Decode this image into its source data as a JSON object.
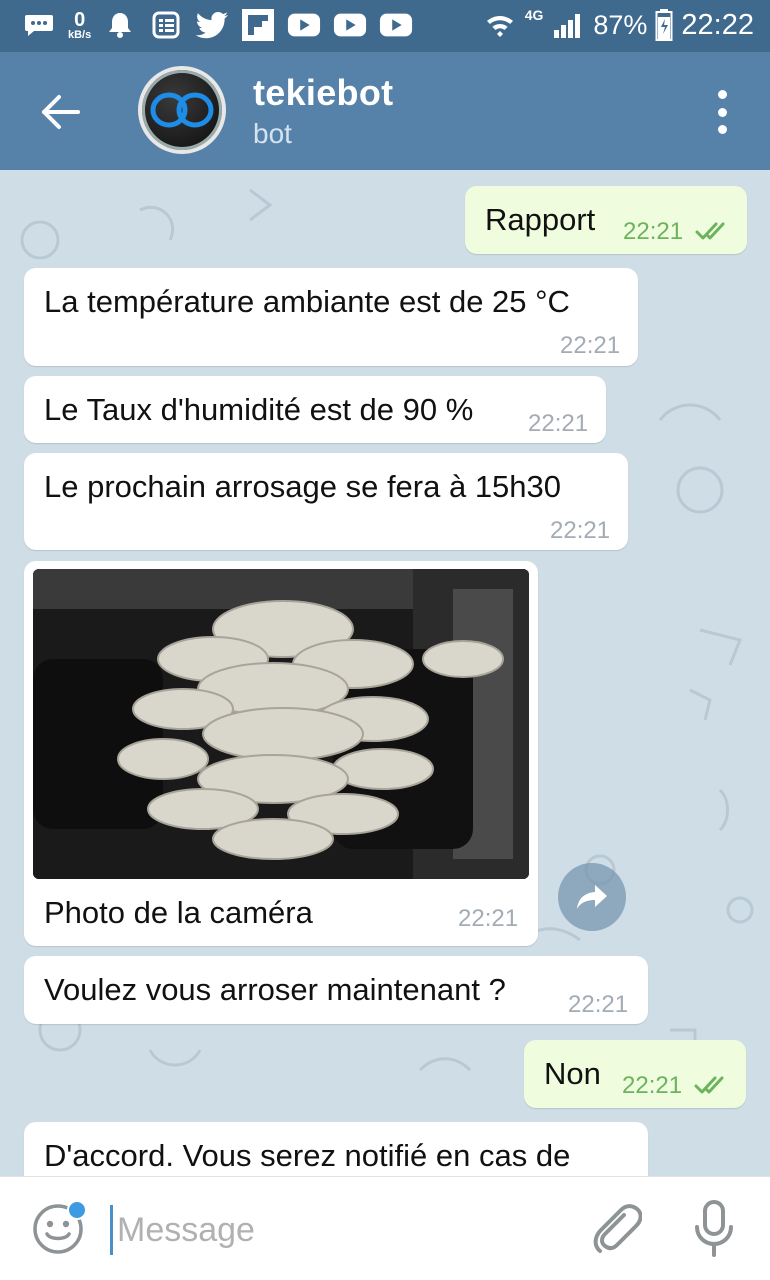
{
  "status_bar": {
    "net_speed_value": "0",
    "net_speed_unit": "kB/s",
    "network_label": "4G",
    "battery_percent": "87%",
    "time": "22:22",
    "icons": [
      "chat-bubble-icon",
      "bell-icon",
      "news-icon",
      "twitter-icon",
      "flipboard-icon",
      "youtube-icon",
      "youtube-icon",
      "youtube-icon",
      "wifi-icon",
      "signal-icon",
      "battery-icon"
    ]
  },
  "header": {
    "title": "tekiebot",
    "subtitle": "bot",
    "back_icon": "arrow-left-icon",
    "menu_icon": "more-vertical-icon"
  },
  "messages": [
    {
      "direction": "out",
      "text": "Rapport",
      "time": "22:21",
      "status": "read"
    },
    {
      "direction": "in",
      "text": "La température ambiante est de 25 °C",
      "time": "22:21"
    },
    {
      "direction": "in",
      "text": "Le Taux d'humidité est de 90 %",
      "time": "22:21"
    },
    {
      "direction": "in",
      "text": "Le prochain arrosage se fera à 15h30",
      "time": "22:21"
    },
    {
      "direction": "in",
      "type": "photo",
      "caption": "Photo de la caméra",
      "time": "22:21"
    },
    {
      "direction": "in",
      "text": "Voulez vous arroser maintenant ?",
      "time": "22:21"
    },
    {
      "direction": "out",
      "text": "Non",
      "time": "22:21",
      "status": "read"
    },
    {
      "direction": "in",
      "text": "D'accord. Vous serez notifié en cas de",
      "time": ""
    }
  ],
  "input": {
    "placeholder": "Message",
    "value": ""
  },
  "colors": {
    "status_bar": "#3f6a8e",
    "header": "#5682a9",
    "outgoing_bubble": "#effdde",
    "incoming_bubble": "#ffffff",
    "read_check": "#6cb35e",
    "emoji_dot": "#3d9be2"
  }
}
